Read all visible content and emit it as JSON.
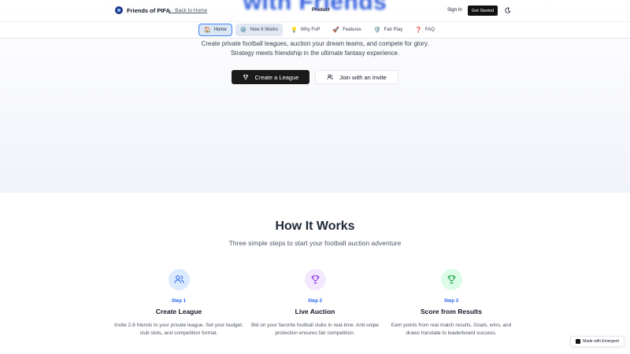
{
  "header": {
    "hero_partial_title": "with Friends",
    "brand_name": "Friends of PIFA",
    "back_link": "← Back to Home",
    "product_link": "Product",
    "sign_in": "Sign In",
    "get_started": "Get Started"
  },
  "nav": {
    "tabs": [
      {
        "label": "Home",
        "icon": "home-icon"
      },
      {
        "label": "How It Works",
        "icon": "gear-icon"
      },
      {
        "label": "Why FoP",
        "icon": "lightbulb-icon"
      },
      {
        "label": "Features",
        "icon": "rocket-icon"
      },
      {
        "label": "Fair Play",
        "icon": "shield-icon"
      },
      {
        "label": "FAQ",
        "icon": "question-icon"
      }
    ]
  },
  "hero": {
    "description": "Create private football leagues, auction your dream teams, and compete for glory. Strategy meets friendship in the ultimate fantasy experience.",
    "create_button": "Create a League",
    "join_button": "Join with an Invite"
  },
  "how_it_works": {
    "title": "How It Works",
    "subtitle": "Three simple steps to start your football auction adventure",
    "steps": [
      {
        "step": "Step 1",
        "title": "Create League",
        "description": "Invite 2-8 friends to your private league. Set your budget, club slots, and competition format.",
        "icon": "users-icon",
        "color": "#dbeafe"
      },
      {
        "step": "Step 2",
        "title": "Live Auction",
        "description": "Bid on your favorite football clubs in real-time. Anti-snipe protection ensures fair competition.",
        "icon": "trophy-icon",
        "color": "#f3e8ff"
      },
      {
        "step": "Step 3",
        "title": "Score from Results",
        "description": "Earn points from real match results. Goals, wins, and draws translate to leaderboard success.",
        "icon": "trophy-icon",
        "color": "#dcfce7"
      }
    ]
  },
  "badge": {
    "label": "Made with Emergent"
  },
  "colors": {
    "accent": "#2563eb",
    "dark_button": "#1a1a1a"
  }
}
